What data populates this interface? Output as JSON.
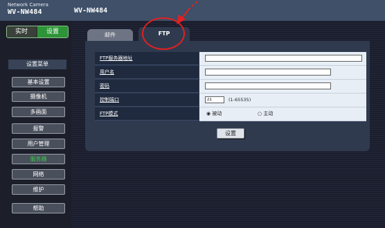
{
  "brand": {
    "subtitle": "Network Camera",
    "model": "WV-NW484"
  },
  "header": {
    "title": "WV-NW484"
  },
  "mode": {
    "live_label": "实时",
    "setup_label": "设置"
  },
  "sidebar": {
    "title": "设置菜单",
    "items": [
      {
        "label": "基本设置"
      },
      {
        "label": "摄像机"
      },
      {
        "label": "多画面"
      },
      {
        "label": "报警"
      },
      {
        "label": "用户管理"
      },
      {
        "label": "服务器"
      },
      {
        "label": "网络"
      },
      {
        "label": "维护"
      },
      {
        "label": "帮助"
      }
    ]
  },
  "tabs": [
    {
      "label": "邮件"
    },
    {
      "label": "FTP"
    }
  ],
  "form": {
    "fields": [
      {
        "label": "FTP服务器地址",
        "value": ""
      },
      {
        "label": "用户名",
        "value": ""
      },
      {
        "label": "密码",
        "value": ""
      },
      {
        "label": "控制端口",
        "value": "21",
        "hint": "(1-65535)"
      },
      {
        "label": "FTP模式",
        "option1": "被动",
        "option2": "主动",
        "selected": "被动"
      }
    ],
    "submit_label": "设置"
  },
  "colors": {
    "header": "#3f5068",
    "sidebar": "#1c1f2a",
    "active_green": "#2d9437",
    "panel": "#2f3a4f",
    "annotation": "#e32020"
  }
}
